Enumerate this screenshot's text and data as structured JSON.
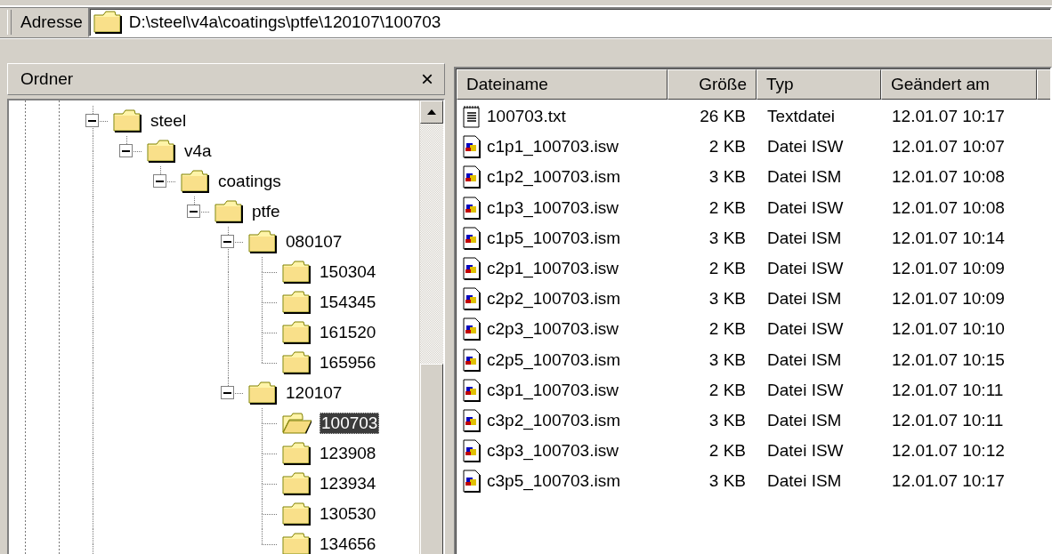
{
  "address_bar": {
    "label": "Adresse",
    "path": "D:\\steel\\v4a\\coatings\\ptfe\\120107\\100703"
  },
  "folders_pane": {
    "title": "Ordner",
    "close": "×",
    "tree": [
      {
        "label": "steel",
        "expanded": true,
        "selected": false,
        "children": [
          {
            "label": "v4a",
            "expanded": true,
            "selected": false,
            "children": [
              {
                "label": "coatings",
                "expanded": true,
                "selected": false,
                "children": [
                  {
                    "label": "ptfe",
                    "expanded": true,
                    "selected": false,
                    "children": [
                      {
                        "label": "080107",
                        "expanded": true,
                        "selected": false,
                        "children": [
                          {
                            "label": "150304",
                            "selected": false
                          },
                          {
                            "label": "154345",
                            "selected": false
                          },
                          {
                            "label": "161520",
                            "selected": false
                          },
                          {
                            "label": "165956",
                            "selected": false
                          }
                        ]
                      },
                      {
                        "label": "120107",
                        "expanded": true,
                        "selected": false,
                        "children": [
                          {
                            "label": "100703",
                            "selected": true
                          },
                          {
                            "label": "123908",
                            "selected": false
                          },
                          {
                            "label": "123934",
                            "selected": false
                          },
                          {
                            "label": "130530",
                            "selected": false
                          },
                          {
                            "label": "134656",
                            "selected": false
                          }
                        ]
                      }
                    ]
                  }
                ]
              }
            ]
          }
        ]
      }
    ]
  },
  "file_list": {
    "columns": [
      "Dateiname",
      "Größe",
      "Typ",
      "Geändert am"
    ],
    "rows": [
      {
        "kind": "text",
        "name": "100703.txt",
        "size": "26 KB",
        "type": "Textdatei",
        "modified": "12.01.07 10:17"
      },
      {
        "kind": "program",
        "name": "c1p1_100703.isw",
        "size": "2 KB",
        "type": "Datei ISW",
        "modified": "12.01.07 10:07"
      },
      {
        "kind": "program",
        "name": "c1p2_100703.ism",
        "size": "3 KB",
        "type": "Datei ISM",
        "modified": "12.01.07 10:08"
      },
      {
        "kind": "program",
        "name": "c1p3_100703.isw",
        "size": "2 KB",
        "type": "Datei ISW",
        "modified": "12.01.07 10:08"
      },
      {
        "kind": "program",
        "name": "c1p5_100703.ism",
        "size": "3 KB",
        "type": "Datei ISM",
        "modified": "12.01.07 10:14"
      },
      {
        "kind": "program",
        "name": "c2p1_100703.isw",
        "size": "2 KB",
        "type": "Datei ISW",
        "modified": "12.01.07 10:09"
      },
      {
        "kind": "program",
        "name": "c2p2_100703.ism",
        "size": "3 KB",
        "type": "Datei ISM",
        "modified": "12.01.07 10:09"
      },
      {
        "kind": "program",
        "name": "c2p3_100703.isw",
        "size": "2 KB",
        "type": "Datei ISW",
        "modified": "12.01.07 10:10"
      },
      {
        "kind": "program",
        "name": "c2p5_100703.ism",
        "size": "3 KB",
        "type": "Datei ISM",
        "modified": "12.01.07 10:15"
      },
      {
        "kind": "program",
        "name": "c3p1_100703.isw",
        "size": "2 KB",
        "type": "Datei ISW",
        "modified": "12.01.07 10:11"
      },
      {
        "kind": "program",
        "name": "c3p2_100703.ism",
        "size": "3 KB",
        "type": "Datei ISM",
        "modified": "12.01.07 10:11"
      },
      {
        "kind": "program",
        "name": "c3p3_100703.isw",
        "size": "2 KB",
        "type": "Datei ISW",
        "modified": "12.01.07 10:12"
      },
      {
        "kind": "program",
        "name": "c3p5_100703.ism",
        "size": "3 KB",
        "type": "Datei ISM",
        "modified": "12.01.07 10:17"
      }
    ]
  }
}
